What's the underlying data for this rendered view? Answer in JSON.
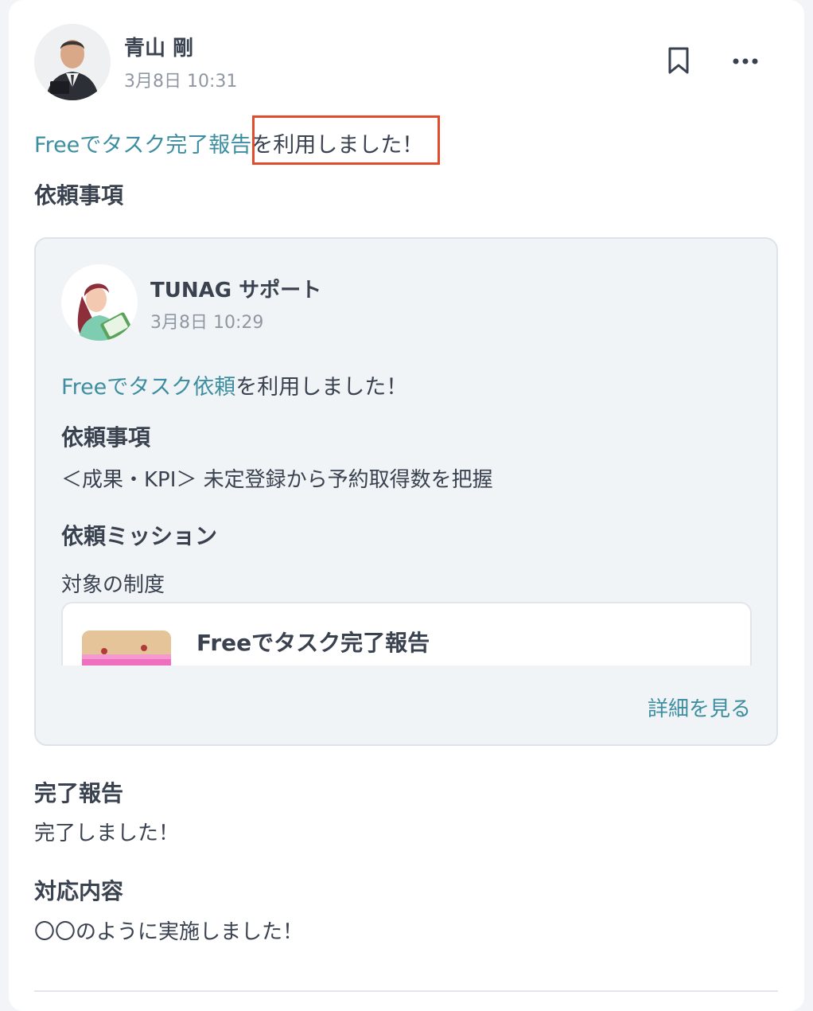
{
  "post": {
    "author_name": "青山 剛",
    "date": "3月8日 10:31",
    "usage_link": "Freeでタスク完了報告",
    "usage_suffix": "を利用しました！",
    "section_request_heading": "依頼事項",
    "icons": {
      "bookmark": "bookmark-icon",
      "more": "more-icon"
    },
    "colors": {
      "link": "#3c8ea0",
      "highlight": "#e24b2c"
    }
  },
  "quoted": {
    "author_name": "TUNAG サポート",
    "date": "3月8日 10:29",
    "usage_link": "Freeでタスク依頼",
    "usage_suffix": "を利用しました！",
    "request_heading": "依頼事項",
    "request_text": "＜成果・KPI＞ 未定登録から予約取得数を把握",
    "mission_heading": "依頼ミッション",
    "target_label": "対象の制度",
    "system_title": "Freeでタスク完了報告",
    "detail_link": "詳細を見る"
  },
  "report": {
    "complete_heading": "完了報告",
    "complete_text": "完了しました！",
    "response_heading": "対応内容",
    "response_text": "〇〇のように実施しました！"
  }
}
